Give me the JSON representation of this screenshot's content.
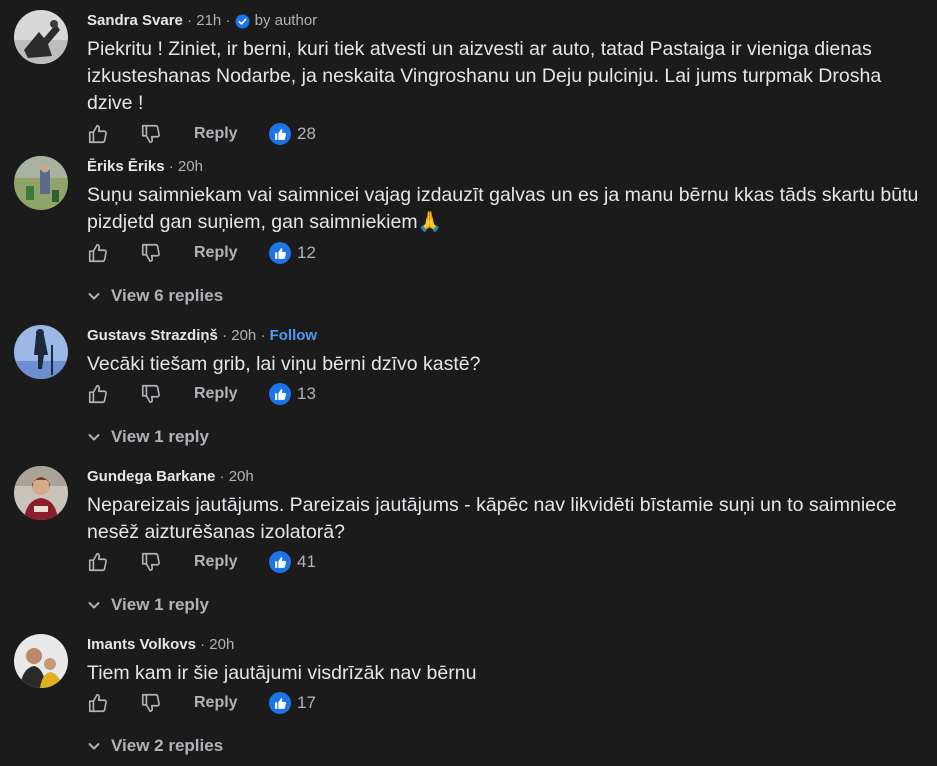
{
  "comments": [
    {
      "author": "Sandra Svare",
      "time": "21h",
      "badge": "by author",
      "text": "Piekritu ! Ziniet, ir berni, kuri tiek atvesti un aizvesti ar auto, tatad Pastaiga ir vieniga dienas izkusteshanas Nodarbe, ja neskaita Vingroshanu un Deju pulcinju. Lai jums turpmak Drosha dzive !",
      "reply_label": "Reply",
      "likes": "28"
    },
    {
      "author": "Ēriks Ēriks",
      "time": "20h",
      "text": "Suņu saimniekam vai saimnicei vajag izdauzīt galvas un es ja manu bērnu kkas tāds skartu būtu pizdjetd gan suņiem, gan saimniekiem🙏",
      "reply_label": "Reply",
      "likes": "12",
      "view_replies": "View 6 replies"
    },
    {
      "author": "Gustavs Strazdiņš",
      "time": "20h",
      "follow": "Follow",
      "text": "Vecāki tiešam grib, lai viņu bērni dzīvo kastē?",
      "reply_label": "Reply",
      "likes": "13",
      "view_replies": "View 1 reply"
    },
    {
      "author": "Gundega Barkane",
      "time": "20h",
      "text": "Nepareizais jautājums. Pareizais jautājums - kāpēc nav likvidēti bīstamie suņi un to saimniece nesēž aizturēšanas izolatorā?",
      "reply_label": "Reply",
      "likes": "41",
      "view_replies": "View 1 reply"
    },
    {
      "author": "Imants Volkovs",
      "time": "20h",
      "text": "Tiem kam ir šie jautājumi visdrīzāk nav bērnu",
      "reply_label": "Reply",
      "likes": "17",
      "view_replies": "View 2 replies"
    }
  ],
  "separator": "·",
  "colors": {
    "background": "#1b1b1b",
    "text": "#e4e6eb",
    "muted": "#b0b3b8",
    "accent": "#1d74e8",
    "follow": "#4b9bf7"
  },
  "icons": {
    "like": "thumbs-up-outline-icon",
    "dislike": "thumbs-down-outline-icon",
    "like_badge": "like-reaction-icon",
    "author_badge": "verified-author-icon",
    "expand": "chevron-down-icon"
  }
}
